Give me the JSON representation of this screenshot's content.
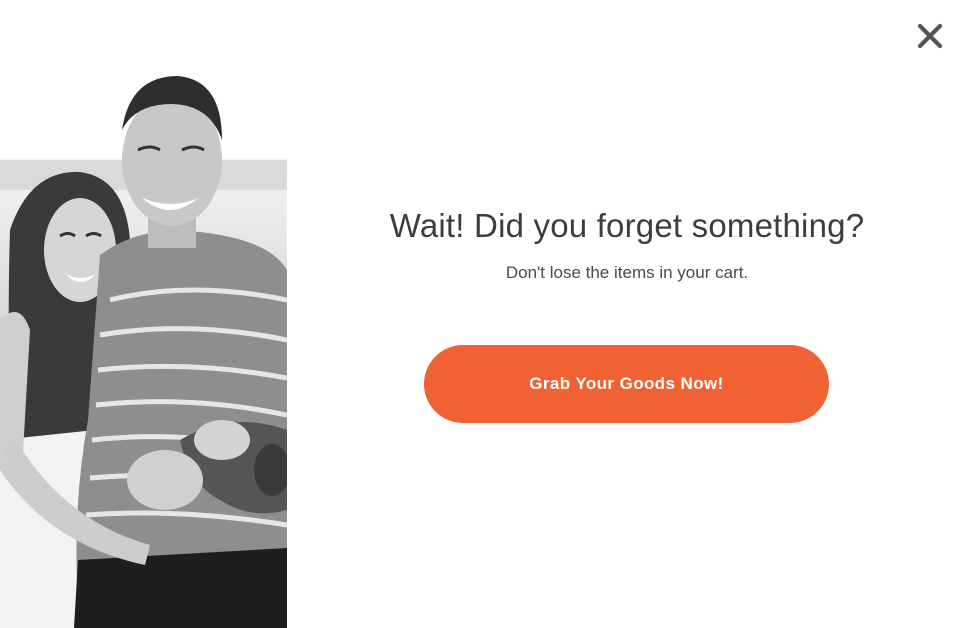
{
  "popup": {
    "headline": "Wait! Did you forget something?",
    "subtext": "Don't lose the items in your cart.",
    "cta_label": "Grab Your Goods Now!",
    "close_icon": "close-icon",
    "photo_description_icon": "couple-photo",
    "colors": {
      "cta_background": "#f06233",
      "cta_text": "#ffffff",
      "headline": "#3d3d3d",
      "close_icon": "#555555"
    }
  }
}
